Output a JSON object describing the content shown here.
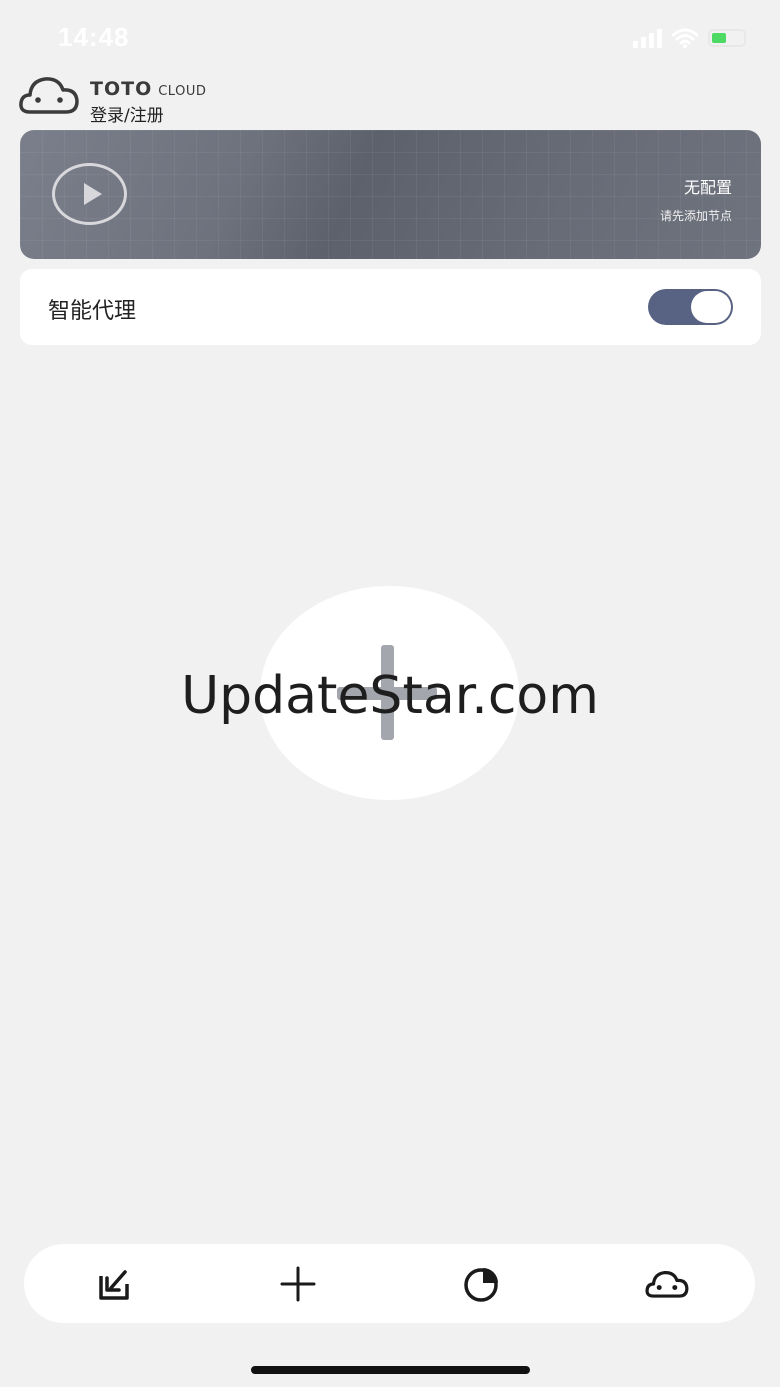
{
  "status_bar": {
    "time": "14:48",
    "icons": [
      "signal-icon",
      "wifi-icon",
      "battery-charging-icon"
    ],
    "battery_color": "#4cd964"
  },
  "header": {
    "logo_icon": "cloud-face-icon",
    "brand_name": "TOTO",
    "brand_suffix": "CLOUD",
    "login_label": "登录/注册"
  },
  "config_card": {
    "play_icon": "play-icon",
    "title": "无配置",
    "subtitle": "请先添加节点"
  },
  "smart_proxy": {
    "label": "智能代理",
    "enabled": true,
    "accent_color": "#586383"
  },
  "main": {
    "add_icon": "plus-icon",
    "watermark": "UpdateStar.com"
  },
  "tab_bar": {
    "items": [
      {
        "icon": "import-icon"
      },
      {
        "icon": "add-icon"
      },
      {
        "icon": "pie-chart-icon"
      },
      {
        "icon": "cloud-face-icon"
      }
    ]
  }
}
